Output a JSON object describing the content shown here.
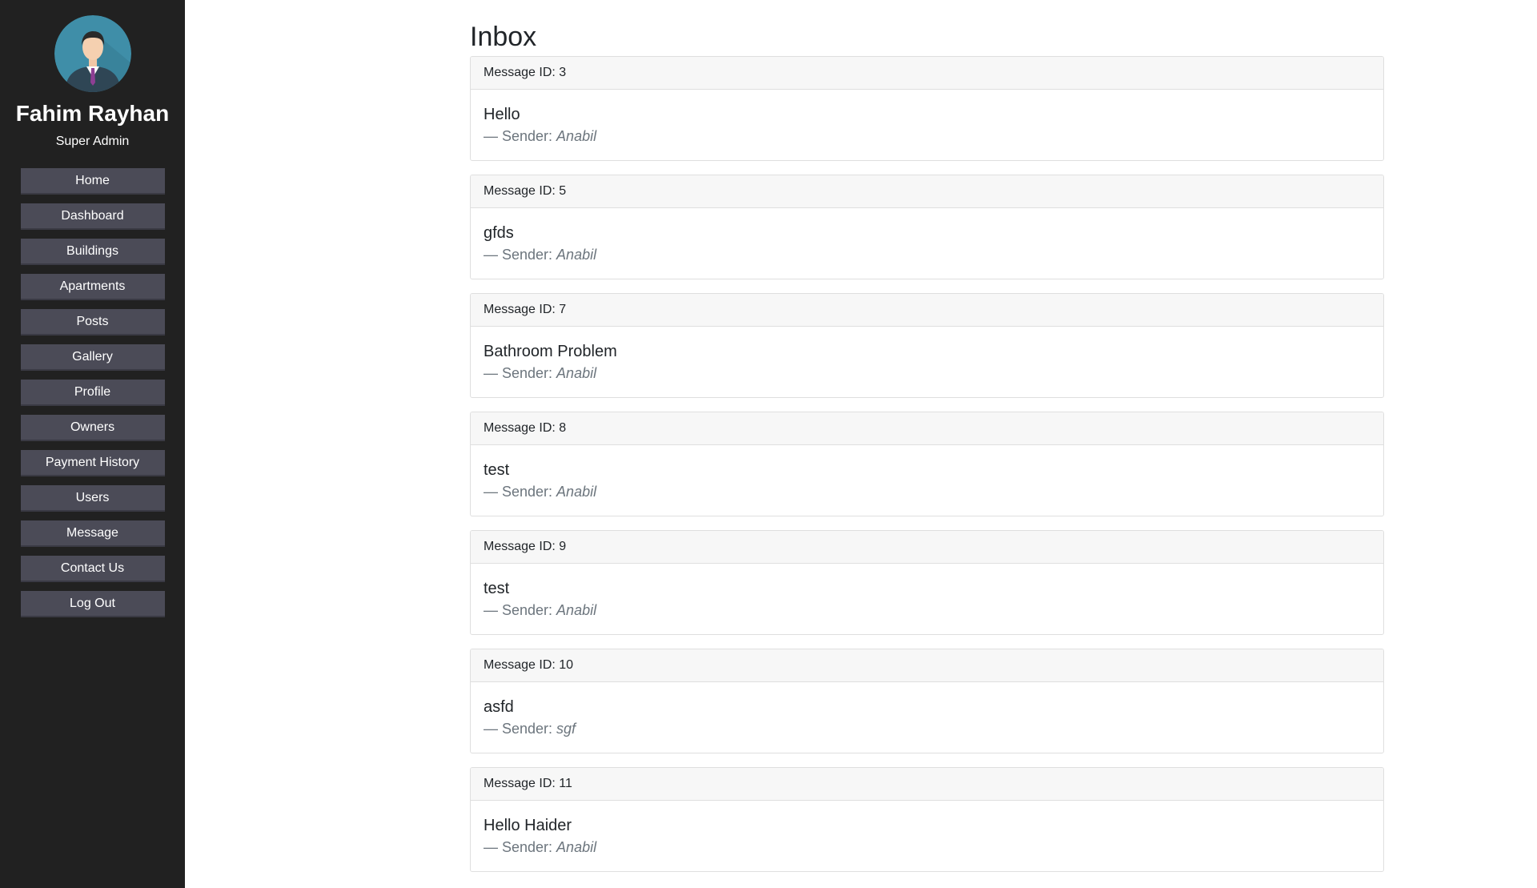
{
  "user": {
    "name": "Fahim Rayhan",
    "role": "Super Admin"
  },
  "nav": [
    {
      "label": "Home"
    },
    {
      "label": "Dashboard"
    },
    {
      "label": "Buildings"
    },
    {
      "label": "Apartments"
    },
    {
      "label": "Posts"
    },
    {
      "label": "Gallery"
    },
    {
      "label": "Profile"
    },
    {
      "label": "Owners"
    },
    {
      "label": "Payment History"
    },
    {
      "label": "Users"
    },
    {
      "label": "Message"
    },
    {
      "label": "Contact Us"
    },
    {
      "label": "Log Out"
    }
  ],
  "page": {
    "title": "Inbox"
  },
  "messages": [
    {
      "header": "Message ID: 3",
      "text": "Hello",
      "sender_prefix": "— Sender: ",
      "sender": "Anabil"
    },
    {
      "header": "Message ID: 5",
      "text": "gfds",
      "sender_prefix": "— Sender: ",
      "sender": "Anabil"
    },
    {
      "header": "Message ID: 7",
      "text": "Bathroom Problem",
      "sender_prefix": "— Sender: ",
      "sender": "Anabil"
    },
    {
      "header": "Message ID: 8",
      "text": "test",
      "sender_prefix": "— Sender: ",
      "sender": "Anabil"
    },
    {
      "header": "Message ID: 9",
      "text": "test",
      "sender_prefix": "— Sender: ",
      "sender": "Anabil"
    },
    {
      "header": "Message ID: 10",
      "text": "asfd",
      "sender_prefix": "— Sender: ",
      "sender": "sgf"
    },
    {
      "header": "Message ID: 11",
      "text": "Hello Haider",
      "sender_prefix": "— Sender: ",
      "sender": "Anabil"
    }
  ],
  "icons": {
    "avatar": "user-avatar-icon"
  },
  "colors": {
    "sidebar_bg": "#212121",
    "nav_button_bg": "#4b4b57",
    "card_header_bg": "#f7f7f7",
    "muted_text": "#6c757d"
  }
}
